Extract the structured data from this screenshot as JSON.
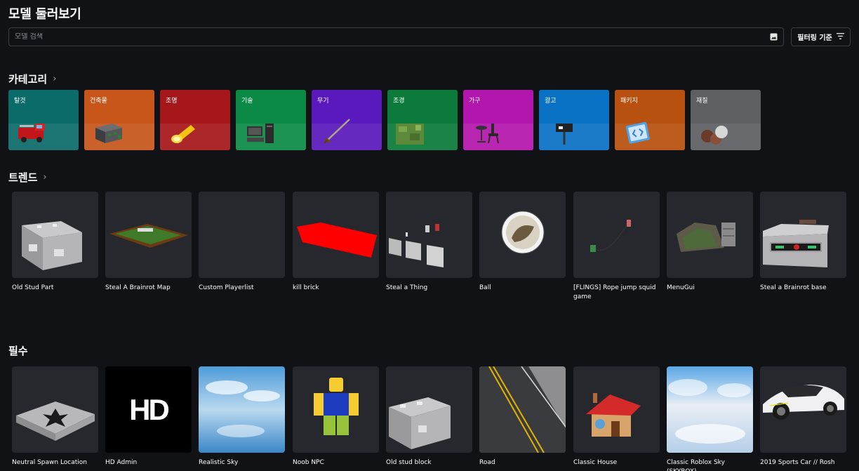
{
  "page": {
    "title": "모델 둘러보기"
  },
  "search": {
    "placeholder": "모델 검색"
  },
  "filter": {
    "label": "필터링 기준"
  },
  "categories_section": {
    "title": "카테고리"
  },
  "categories": [
    {
      "label": "탈것",
      "color": "#0b6b69"
    },
    {
      "label": "건축물",
      "color": "#c8561a"
    },
    {
      "label": "조명",
      "color": "#a5171a"
    },
    {
      "label": "기술",
      "color": "#0b8a46"
    },
    {
      "label": "무기",
      "color": "#5a19bc"
    },
    {
      "label": "조경",
      "color": "#0b7a3a"
    },
    {
      "label": "가구",
      "color": "#b316ad"
    },
    {
      "label": "광고",
      "color": "#0a72c4"
    },
    {
      "label": "패키지",
      "color": "#b8500f"
    },
    {
      "label": "재질",
      "color": "#5e5f63"
    }
  ],
  "trends_section": {
    "title": "트렌드"
  },
  "trends": [
    {
      "label": "Old Stud Part"
    },
    {
      "label": "Steal A Brainrot Map"
    },
    {
      "label": "Custom Playerlist"
    },
    {
      "label": "kill brick"
    },
    {
      "label": "Steal a Thing"
    },
    {
      "label": "Ball"
    },
    {
      "label": "[FLINGS] Rope jump squid game"
    },
    {
      "label": "MenuGui"
    },
    {
      "label": "Steal a Brainrot base"
    }
  ],
  "essentials_section": {
    "title": "필수"
  },
  "essentials": [
    {
      "label": "Neutral Spawn Location"
    },
    {
      "label": "HD Admin",
      "thumb_text": "HD"
    },
    {
      "label": "Realistic Sky"
    },
    {
      "label": "Noob NPC"
    },
    {
      "label": "Old stud block"
    },
    {
      "label": "Road"
    },
    {
      "label": "Classic House"
    },
    {
      "label": "Classic Roblox Sky (SKYBOX)"
    },
    {
      "label": "2019 Sports Car // Rosh"
    }
  ]
}
